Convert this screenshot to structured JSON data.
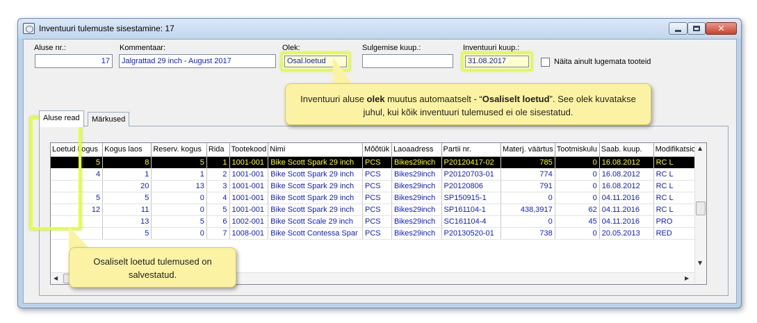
{
  "window": {
    "title": "Inventuuri tulemuste sisestamine: 17",
    "icon": "app-icon",
    "controls": [
      "minimize-icon",
      "maximize-icon",
      "close-icon"
    ]
  },
  "form": {
    "aluse_label": "Aluse nr.:",
    "aluse_value": "17",
    "kommentaar_label": "Kommentaar:",
    "kommentaar_value": "Jalgrattad 29 inch - August 2017",
    "olek_label": "Olek:",
    "olek_value": "Osal.loetud",
    "sulgemise_label": "Sulgemise kuup.:",
    "sulgemise_value": "",
    "inventuuri_label": "Inventuuri kuup.:",
    "inventuuri_value": "31.08.2017",
    "naita_label": "Näita ainult lugemata tooteid"
  },
  "tabs": [
    {
      "label": "Aluse read",
      "active": true
    },
    {
      "label": "Märkused",
      "active": false
    }
  ],
  "grid": {
    "columns": [
      "Loetud kogus",
      "Kogus laos",
      "Reserv. kogus",
      "Rida",
      "Tootekood",
      "Nimi",
      "Mõõtük",
      "Laoaadress",
      "Partii nr.",
      "Materj. väärtus",
      "Tootmiskulu",
      "Saab. kuup.",
      "Modifikatsioon"
    ],
    "rows": [
      [
        "5",
        "8",
        "5",
        "1",
        "1001-001",
        "Bike Scott Spark 29 inch",
        "PCS",
        "Bikes29inch",
        "P20120417-02",
        "785",
        "0",
        "16.08.2012",
        "RC L"
      ],
      [
        "4",
        "1",
        "1",
        "2",
        "1001-001",
        "Bike Scott Spark 29 inch",
        "PCS",
        "Bikes29inch",
        "P20120703-01",
        "774",
        "0",
        "16.08.2012",
        "RC L"
      ],
      [
        "",
        "20",
        "13",
        "3",
        "1001-001",
        "Bike Scott Spark 29 inch",
        "PCS",
        "Bikes29inch",
        "P20120806",
        "791",
        "0",
        "16.08.2012",
        "RC L"
      ],
      [
        "5",
        "5",
        "0",
        "4",
        "1001-001",
        "Bike Scott Spark 29 inch",
        "PCS",
        "Bikes29inch",
        "SP150915-1",
        "0",
        "0",
        "04.11.2016",
        "RC L"
      ],
      [
        "12",
        "11",
        "0",
        "5",
        "1001-001",
        "Bike Scott Spark 29 inch",
        "PCS",
        "Bikes29inch",
        "SP161104-1",
        "438,3917",
        "62",
        "04.11.2016",
        "RC L"
      ],
      [
        "",
        "13",
        "5",
        "6",
        "1002-001",
        "Bike Scott Scale 29 inch",
        "PCS",
        "Bikes29inch",
        "SC161104-4",
        "0",
        "45",
        "04.11.2016",
        "PRO"
      ],
      [
        "",
        "5",
        "0",
        "7",
        "1008-001",
        "Bike Scott Contessa Spar",
        "PCS",
        "Bikes29inch",
        "P20130520-01",
        "738",
        "0",
        "20.05.2013",
        "RED"
      ]
    ],
    "selected_row": 0
  },
  "callouts": {
    "top_before": "Inventuuri aluse ",
    "top_bold1": "olek",
    "top_mid": " muutus automaatselt - “",
    "top_bold2": "Osaliselt loetud",
    "top_after": "”.  See olek kuvatakse juhul, kui kõik inventuuri tulemused ei ole sisestatud.",
    "bottom": "Osaliselt loetud tulemused on salvestatud."
  },
  "colors": {
    "highlight": "#e6ff3a",
    "callout_bg": "#fbf3a3",
    "selected_row_bg": "#000000",
    "selected_row_text": "#ffff00",
    "cell_text": "#1020c8"
  }
}
